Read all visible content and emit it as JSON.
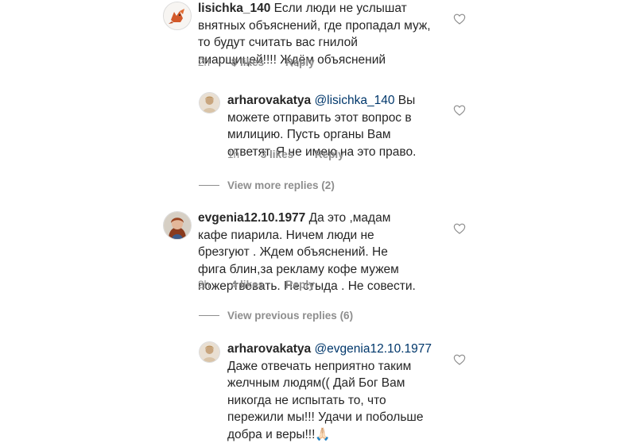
{
  "comments": [
    {
      "username": "lisichka_140",
      "mention": "",
      "text": "Если люди не услышат внятных объяснений, где пропадал муж, то будут считать вас гнилой пиарщицей!!!! Ждём объяснений",
      "time": "2h",
      "likes": "8 likes",
      "reply": "Reply",
      "avatar_icon": "fox-avatar-icon"
    },
    {
      "username": "arharovakatya",
      "mention": "@lisichka_140",
      "text": "Вы можете отправить этот вопрос в милицию. Пусть органы Вам ответят. Я не имею на это право.",
      "time": "1h",
      "likes": "3 likes",
      "reply": "Reply",
      "avatar_icon": "portrait-avatar-icon"
    },
    {
      "username": "evgenia12.10.1977",
      "mention": "",
      "text": "Да это ,мадам кафе пиарила. Ничем люди не брезгуют . Ждем объяснений. Не фига блин,за рекламу кофе мужем пожертвовать. Не стыда . Не совести.",
      "time": "2h",
      "likes": "4 likes",
      "reply": "Reply",
      "avatar_icon": "portrait-avatar-icon"
    },
    {
      "username": "arharovakatya",
      "mention": "@evgenia12.10.1977",
      "text": "Даже отвечать неприятно таким желчным людям(( Дай Бог Вам никогда не испытать то, что пережили мы!!! Удачи и побольше добра и веры!!!🙏🏻",
      "time": "",
      "likes": "",
      "reply": "",
      "avatar_icon": "portrait-avatar-icon"
    }
  ],
  "view_more_replies": "View more replies (2)",
  "view_previous_replies": "View previous replies (6)",
  "colors": {
    "text": "#262626",
    "meta": "#8e8e8e",
    "mention": "#00376b"
  }
}
